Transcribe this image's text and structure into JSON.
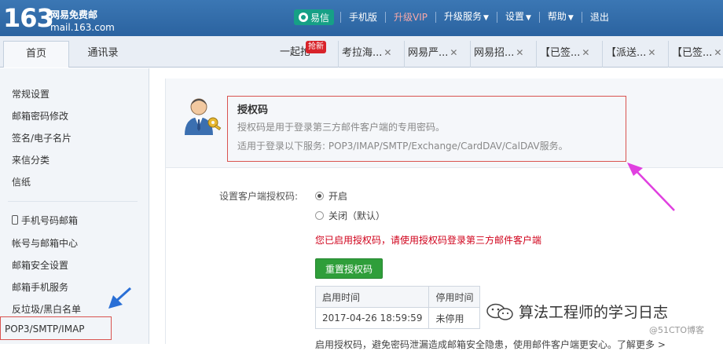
{
  "header": {
    "logo_number": "163",
    "logo_name": "网易免费邮",
    "logo_domain": "mail.163.com",
    "nav": {
      "yixin": "易信",
      "mobile": "手机版",
      "vip": "升级VIP",
      "upgrade_service": "升级服务",
      "settings": "设置",
      "help": "帮助",
      "logout": "退出"
    }
  },
  "tabs": {
    "home": "首页",
    "contacts": "通讯录",
    "new_badge": "抢新",
    "mail_tabs": [
      "一起抢",
      "考拉海...",
      "网易严...",
      "网易招...",
      "【已签...",
      "【派送...",
      "【已签..."
    ]
  },
  "sidebar": {
    "group1": [
      "常规设置",
      "邮箱密码修改",
      "签名/电子名片",
      "来信分类",
      "信纸"
    ],
    "group2": [
      "手机号码邮箱",
      "帐号与邮箱中心",
      "邮箱安全设置",
      "邮箱手机服务",
      "反垃圾/黑白名单",
      "POP3/SMTP/IMAP"
    ]
  },
  "auth": {
    "title": "授权码",
    "desc1": "授权码是用于登录第三方邮件客户端的专用密码。",
    "desc2": "适用于登录以下服务: POP3/IMAP/SMTP/Exchange/CardDAV/CalDAV服务。",
    "set_label": "设置客户端授权码:",
    "option_on": "开启",
    "option_off": "关闭（默认）",
    "enabled_msg": "您已启用授权码，请使用授权码登录第三方邮件客户端",
    "reset_button": "重置授权码",
    "table": {
      "headers": [
        "启用时间",
        "停用时间"
      ],
      "rows": [
        [
          "2017-04-26 18:59:59",
          "未停用"
        ]
      ]
    },
    "footer_note": "启用授权码，避免密码泄漏造成邮箱安全隐患，使用邮件客户端更安心。了解更多 >"
  },
  "watermark": {
    "text": "算法工程师的学习日志",
    "blog": "@51CTO博客"
  },
  "colors": {
    "header_blue": "#2f6aa8",
    "annotation_red": "#d9534f",
    "arrow_magenta": "#e040e0",
    "arrow_blue": "#2a6fd6",
    "button_green": "#2f9e3a",
    "message_red": "#d0021b"
  }
}
